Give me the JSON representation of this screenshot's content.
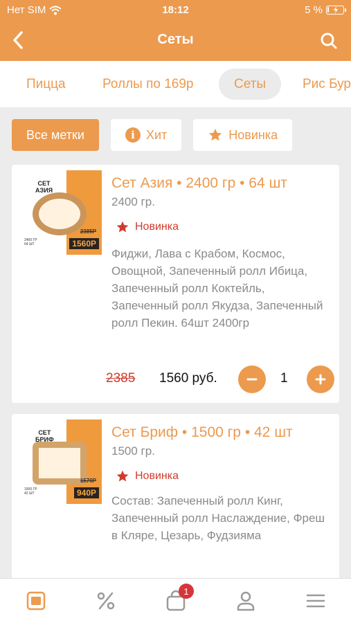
{
  "status_bar": {
    "carrier": "Нет SIM",
    "time": "18:12",
    "battery": "5 %",
    "battery_level": 0.05
  },
  "header": {
    "title": "Сеты"
  },
  "categories": [
    {
      "label": "Пицца",
      "active": false
    },
    {
      "label": "Роллы по 169р",
      "active": false
    },
    {
      "label": "Сеты",
      "active": true
    },
    {
      "label": "Рис Бур",
      "active": false
    }
  ],
  "tags": [
    {
      "label": "Все метки",
      "icon": "",
      "active": true
    },
    {
      "label": "Хит",
      "icon": "info-icon",
      "active": false
    },
    {
      "label": "Новинка",
      "icon": "star-icon",
      "active": false
    }
  ],
  "products": [
    {
      "title": "Сет Азия • 2400 гр • 64 шт",
      "weight": "2400 гр.",
      "badge": "Новинка",
      "description": "Фиджи, Лава с Крабом, Космос, Овощной, Запеченный ролл Ибица, Запеченный ролл Коктейль, Запеченный ролл Якудза, Запеченный ролл Пекин. 64шт 2400гр",
      "old_price": "2385",
      "price": "1560 руб.",
      "quantity": "1",
      "image": {
        "name": "СЕТ\nАЗИЯ",
        "old": "2385Р",
        "price": "1560Р",
        "info": "2400 ГР\n64 ШТ"
      }
    },
    {
      "title": "Сет Бриф • 1500 гр • 42 шт",
      "weight": "1500 гр.",
      "badge": "Новинка",
      "description": "Состав: Запеченный ролл Кинг, Запеченный ролл Наслаждение, Фреш в Кляре, Цезарь, Фудзияма",
      "image": {
        "name": "СЕТ\nБРИФ",
        "old": "1570Р",
        "price": "940Р",
        "info": "1500 ГР\n42 ШТ"
      }
    }
  ],
  "tabbar": {
    "cart_count": "1"
  },
  "colors": {
    "accent": "#ec9a4e",
    "badge_red": "#d23b2c"
  }
}
